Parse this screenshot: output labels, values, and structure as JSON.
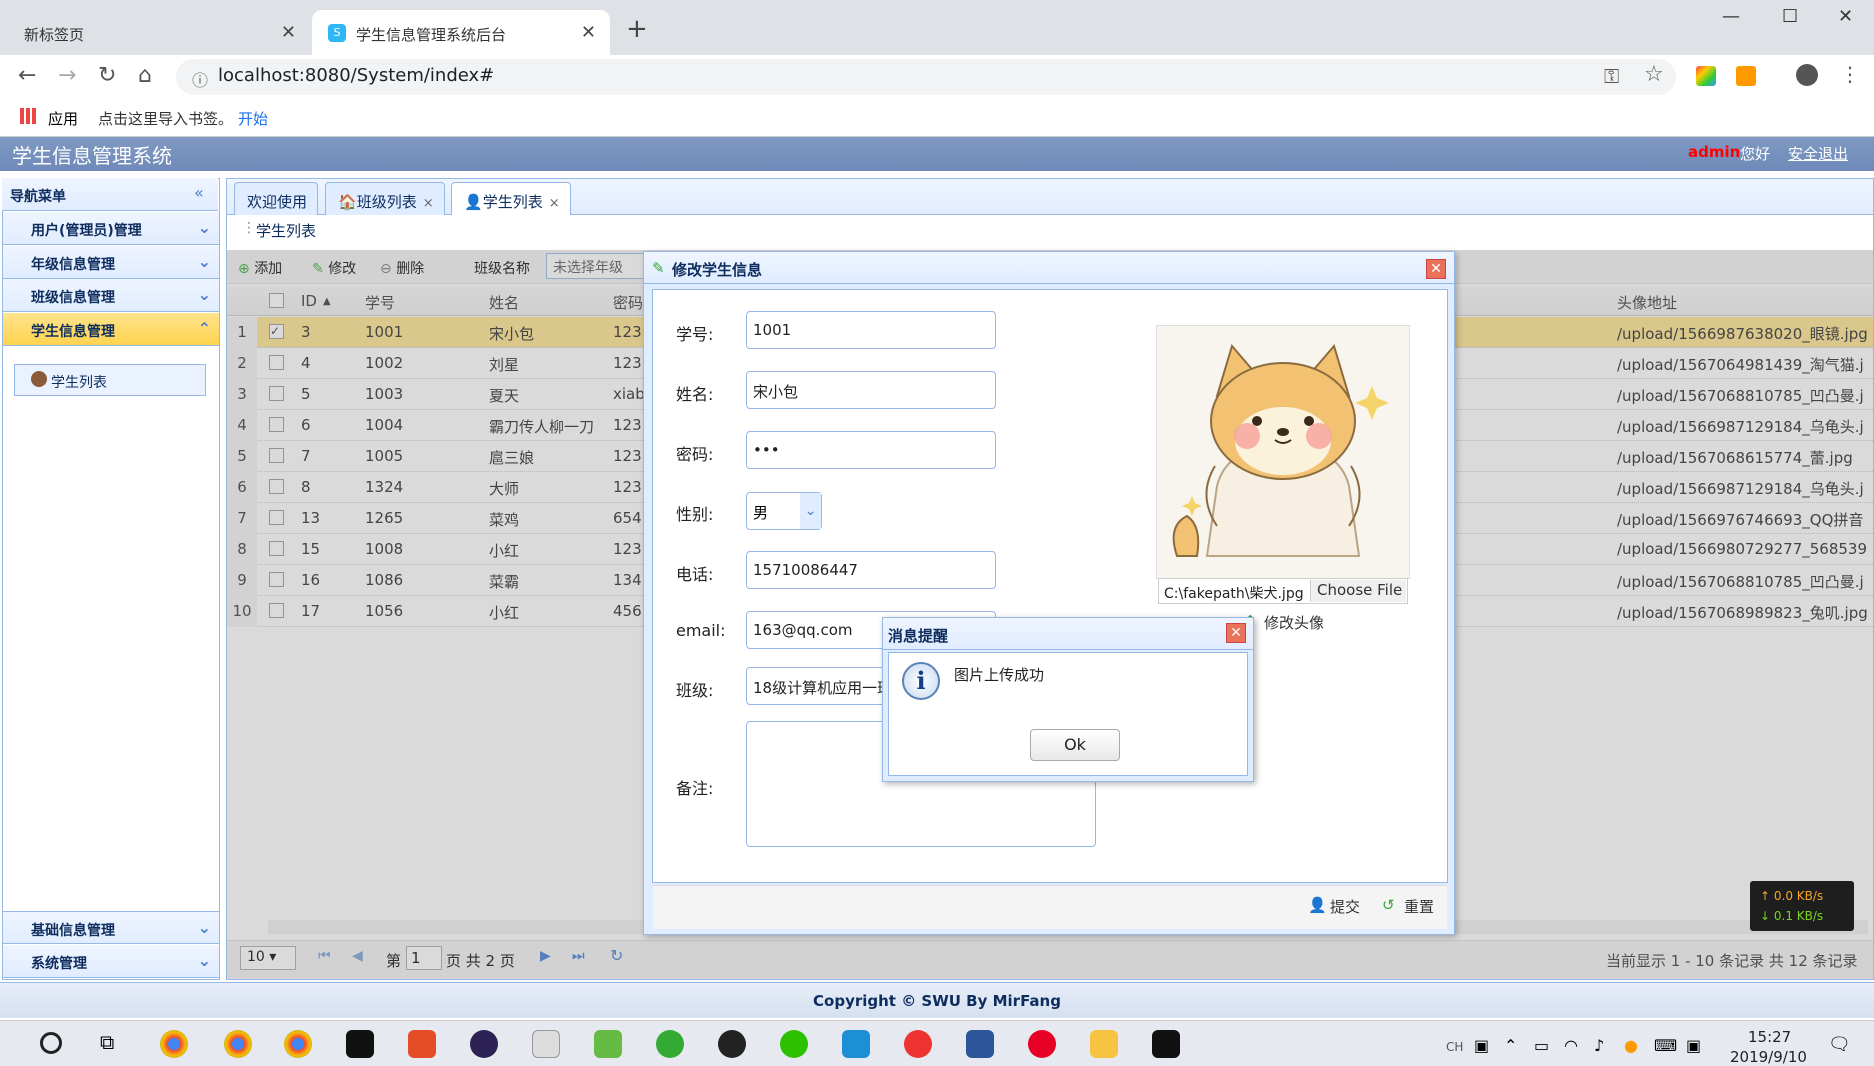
{
  "browser": {
    "tab1_title": "新标签页",
    "tab2_title": "学生信息管理系统后台",
    "url": "localhost:8080/System/index#",
    "bookmarks": {
      "apps": "应用",
      "import_hint": "点击这里导入书签。",
      "start": "开始"
    }
  },
  "app": {
    "title": "学生信息管理系统",
    "user": "admin",
    "greeting": "您好",
    "logout": "安全退出",
    "copyright": "Copyright © SWU By MirFang"
  },
  "sidebar": {
    "title": "导航菜单",
    "groups": [
      {
        "label": "用户(管理员)管理"
      },
      {
        "label": "年级信息管理"
      },
      {
        "label": "班级信息管理"
      },
      {
        "label": "学生信息管理"
      }
    ],
    "active_child": "学生列表",
    "bottom_groups": [
      {
        "label": "基础信息管理"
      },
      {
        "label": "系统管理"
      }
    ]
  },
  "page_tabs": [
    {
      "label": "欢迎使用"
    },
    {
      "label": "班级列表"
    },
    {
      "label": "学生列表"
    }
  ],
  "panel": {
    "title": "学生列表"
  },
  "grid_toolbar": {
    "add": "添加",
    "edit": "修改",
    "delete": "删除",
    "class_name_label": "班级名称",
    "year_select": "未选择年级"
  },
  "grid": {
    "columns": [
      "ID",
      "学号",
      "姓名",
      "密码",
      "头像地址"
    ],
    "rows": [
      {
        "n": "1",
        "id": "3",
        "sn": "1001",
        "name": "宋小包",
        "pwd": "123",
        "avatar": "/upload/1566987638020_眼镜.jpg",
        "checked": true
      },
      {
        "n": "2",
        "id": "4",
        "sn": "1002",
        "name": "刘星",
        "pwd": "123",
        "avatar": "/upload/1567064981439_淘气猫.j"
      },
      {
        "n": "3",
        "id": "5",
        "sn": "1003",
        "name": "夏天",
        "pwd": "xiab",
        "avatar": "/upload/1567068810785_凹凸曼.j"
      },
      {
        "n": "4",
        "id": "6",
        "sn": "1004",
        "name": "霸刀传人柳一刀",
        "pwd": "123",
        "avatar": "/upload/1566987129184_乌龟头.j"
      },
      {
        "n": "5",
        "id": "7",
        "sn": "1005",
        "name": "扈三娘",
        "pwd": "123",
        "avatar": "/upload/1567068615774_蕾.jpg"
      },
      {
        "n": "6",
        "id": "8",
        "sn": "1324",
        "name": "大师",
        "pwd": "123",
        "avatar": "/upload/1566987129184_乌龟头.j"
      },
      {
        "n": "7",
        "id": "13",
        "sn": "1265",
        "name": "菜鸡",
        "pwd": "654",
        "avatar": "/upload/1566976746693_QQ拼音"
      },
      {
        "n": "8",
        "id": "15",
        "sn": "1008",
        "name": "小红",
        "pwd": "123",
        "avatar": "/upload/1566980729277_568539"
      },
      {
        "n": "9",
        "id": "16",
        "sn": "1086",
        "name": "菜霸",
        "pwd": "134",
        "avatar": "/upload/1567068810785_凹凸曼.j"
      },
      {
        "n": "10",
        "id": "17",
        "sn": "1056",
        "name": "小红",
        "pwd": "456",
        "avatar": "/upload/1567068989823_兔叽.jpg"
      }
    ]
  },
  "pager": {
    "page_size": "10",
    "page_label": "第",
    "page": "1",
    "total_pages": "页 共 2 页",
    "summary": "当前显示 1 - 10 条记录 共 12 条记录"
  },
  "dialog": {
    "title": "修改学生信息",
    "labels": {
      "sn": "学号:",
      "name": "姓名:",
      "password": "密码:",
      "gender": "性别:",
      "phone": "电话:",
      "email": "email:",
      "clazz": "班级:",
      "remark": "备注:"
    },
    "values": {
      "sn": "1001",
      "name": "宋小包",
      "password": "•••",
      "gender": "男",
      "phone": "15710086447",
      "email": "163@qq.com",
      "clazz": "18级计算机应用一班"
    },
    "file_path": "C:\\fakepath\\柴犬.jpg",
    "choose_file": "Choose File",
    "edit_avatar": "修改头像",
    "submit": "提交",
    "reset": "重置"
  },
  "msgbox": {
    "title": "消息提醒",
    "text": "图片上传成功",
    "ok": "Ok"
  },
  "netspeed": {
    "up": "↑ 0.0 KB/s",
    "down": "↓ 0.1 KB/s"
  },
  "taskbar": {
    "ime": "CH",
    "time": "15:27",
    "date": "2019/9/10"
  },
  "colors": {
    "header": "#7f99c3",
    "border": "#95b8e7",
    "selected_row": "#ffe48d",
    "admin_red": "#ff0000"
  }
}
